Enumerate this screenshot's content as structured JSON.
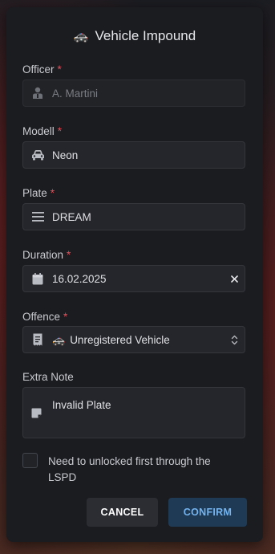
{
  "dialog": {
    "title": "Vehicle Impound",
    "title_icon": "police-car-emoji",
    "required_marker": "*"
  },
  "fields": {
    "officer": {
      "label": "Officer",
      "value": "A. Martini",
      "icon": "user-badge-icon",
      "disabled": true
    },
    "model": {
      "label": "Modell",
      "value": "Neon",
      "icon": "car-icon"
    },
    "plate": {
      "label": "Plate",
      "value": "DREAM",
      "icon": "lines-icon"
    },
    "duration": {
      "label": "Duration",
      "value": "16.02.2025",
      "icon": "calendar-icon",
      "clear_icon": "close-icon"
    },
    "offence": {
      "label": "Offence",
      "value": "Unregistered Vehicle",
      "icon": "receipt-icon",
      "option_icon": "police-car-emoji",
      "chevron_icon": "chevron-up-down-icon"
    },
    "note": {
      "label": "Extra Note",
      "value": "Invalid Plate",
      "icon": "sticky-note-icon"
    }
  },
  "checkbox": {
    "label": "Need to unlocked first through the LSPD",
    "checked": false
  },
  "buttons": {
    "cancel": "CANCEL",
    "confirm": "CONFIRM"
  },
  "colors": {
    "dialog_bg": "#1b1c20",
    "input_bg": "#25262b",
    "required": "#e0505a",
    "confirm_bg": "#1f3a55",
    "confirm_text": "#74b3ee"
  }
}
